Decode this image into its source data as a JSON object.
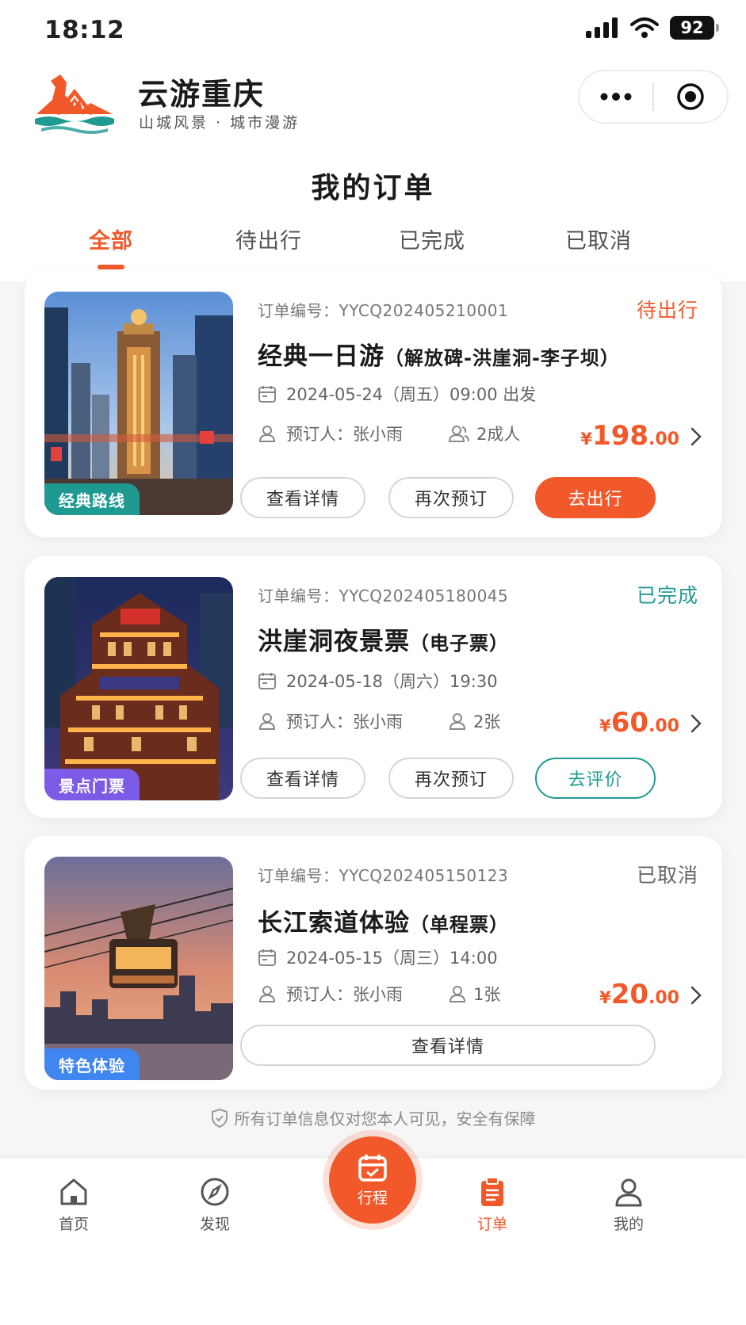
{
  "status_bar": {
    "time": "18:12",
    "battery": "92"
  },
  "header": {
    "title": "云游重庆",
    "subtitle": "山城风景 · 城市漫游"
  },
  "page": {
    "title": "我的订单"
  },
  "tabs": [
    {
      "label": "全部",
      "active": true
    },
    {
      "label": "待出行",
      "active": false
    },
    {
      "label": "已完成",
      "active": false
    },
    {
      "label": "已取消",
      "active": false
    }
  ],
  "orders": [
    {
      "tag": "经典路线",
      "order_no": "订单编号：YYCQ202405210001",
      "status": "待出行",
      "title": "经典一日游",
      "title_sub": "（解放碑-洪崖洞-李子坝）",
      "date": "2024-05-24（周五）09:00 出发",
      "booker": "预订人：张小雨",
      "quantity": "2成人",
      "price_int": "198",
      "price_dec": ".00",
      "buttons": [
        "查看详情",
        "再次预订",
        "去出行"
      ]
    },
    {
      "tag": "景点门票",
      "order_no": "订单编号：YYCQ202405180045",
      "status": "已完成",
      "title": "洪崖洞夜景票",
      "title_sub": "（电子票）",
      "date": "2024-05-18（周六）19:30",
      "booker": "预订人：张小雨",
      "quantity": "2张",
      "price_int": "60",
      "price_dec": ".00",
      "buttons": [
        "查看详情",
        "再次预订",
        "去评价"
      ]
    },
    {
      "tag": "特色体验",
      "order_no": "订单编号：YYCQ202405150123",
      "status": "已取消",
      "title": "长江索道体验",
      "title_sub": "（单程票）",
      "date": "2024-05-15（周三）14:00",
      "booker": "预订人：张小雨",
      "quantity": "1张",
      "price_int": "20",
      "price_dec": ".00",
      "buttons": [
        "查看详情"
      ]
    }
  ],
  "currency": "¥",
  "footer_note": "所有订单信息仅对您本人可见，安全有保障",
  "nav": [
    {
      "label": "首页",
      "icon": "home-icon"
    },
    {
      "label": "发现",
      "icon": "compass-icon"
    },
    {
      "label": "行程",
      "icon": "calendar-icon"
    },
    {
      "label": "订单",
      "icon": "clipboard-icon",
      "active": true
    },
    {
      "label": "我的",
      "icon": "user-icon"
    }
  ],
  "colors": {
    "accent": "#f2592a",
    "teal": "#1f9a92",
    "tag_classic": "#1f9a92",
    "tag_ticket": "#7c5ce6",
    "tag_experience": "#3f86f0",
    "cancelled": "#666666"
  }
}
